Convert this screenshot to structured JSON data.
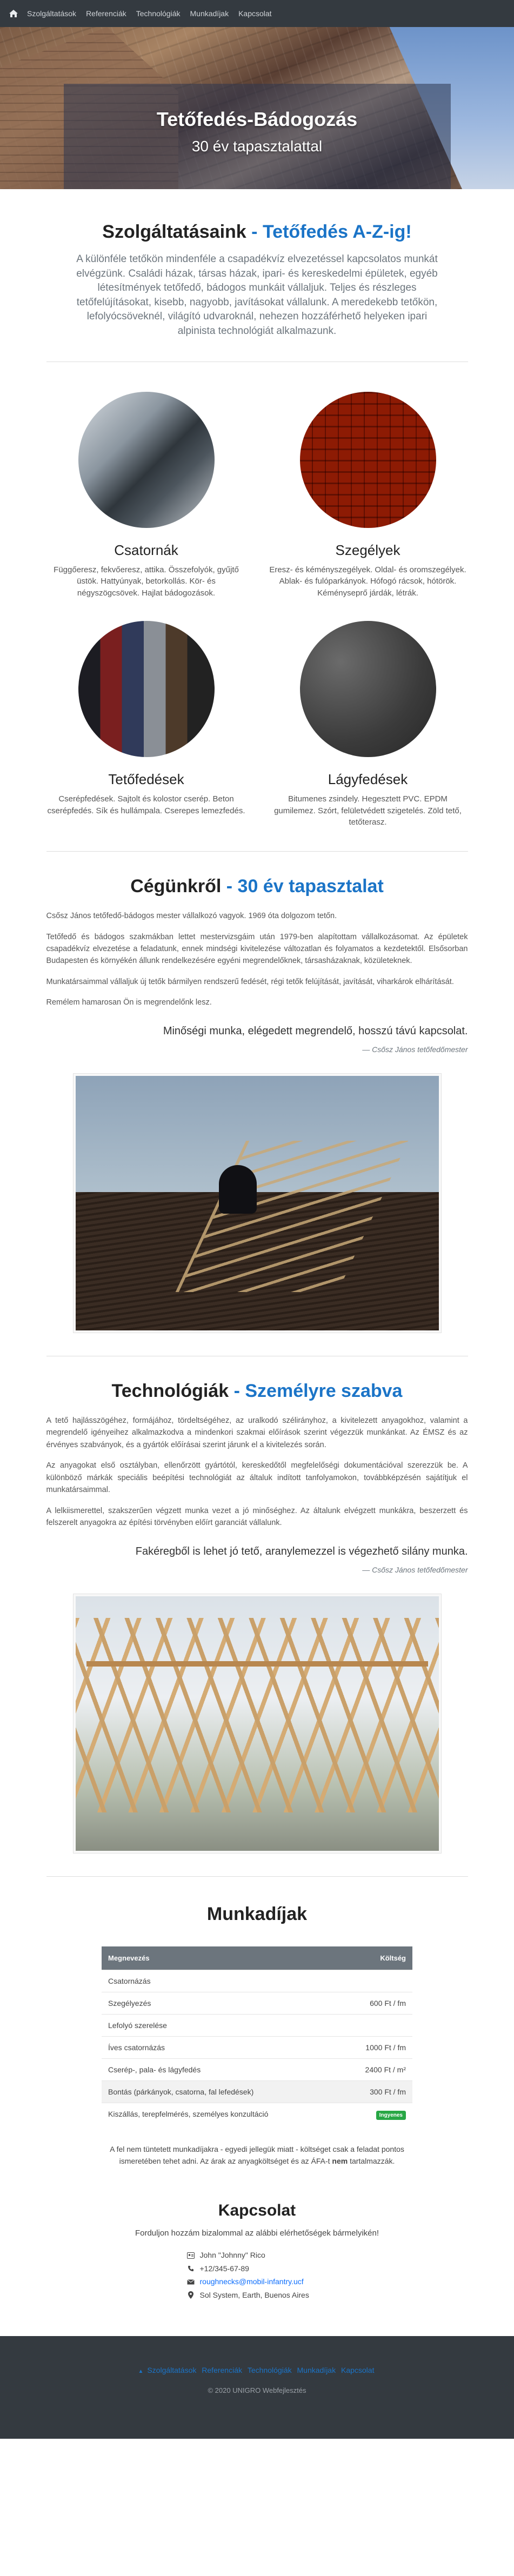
{
  "nav": {
    "items": [
      "Szolgáltatások",
      "Referenciák",
      "Technológiák",
      "Munkadíjak",
      "Kapcsolat"
    ]
  },
  "hero": {
    "title": "Tetőfedés-Bádogozás",
    "subtitle": "30 év tapasztalattal"
  },
  "services_section": {
    "title": "Szolgáltatásaink",
    "accent": "- Tetőfedés A-Z-ig!",
    "lead": "A különféle tetőkön mindenféle a csapadékvíz elvezetéssel kapcsolatos munkát elvégzünk. Családi házak, társas házak, ipari- és kereskedelmi épületek, egyéb létesítmények tetőfedő, bádogos munkáit vállaljuk. Teljes és részleges tetőfelújításokat, kisebb, nagyobb, javításokat vállalunk. A meredekebb tetőkön, lefolyócsöveknél, világító udvaroknál, nehezen hozzáférhető helyeken ipari alpinista technológiát alkalmazunk.",
    "items": [
      {
        "title": "Csatornák",
        "desc": "Függőeresz, fekvőeresz, attika. Összefolyók, gyűjtő üstök. Hattyúnyak, betorkollás. Kör- és négyszögcsövek. Hajlat bádogozások."
      },
      {
        "title": "Szegélyek",
        "desc": "Eresz- és kéményszegélyek. Oldal- és oromszegélyek. Ablak- és fulóparkányok. Hófogó rácsok, hótörök. Kéményseprő járdák, létrák."
      },
      {
        "title": "Tetőfedések",
        "desc": "Cserépfedések. Sajtolt és kolostor cserép. Beton cserépfedés. Sík és hullámpala. Cserepes lemezfedés."
      },
      {
        "title": "Lágyfedések",
        "desc": "Bitumenes zsindely. Hegesztett PVC. EPDM gumilemez. Szórt, felületvédett szigetelés. Zöld tető, tetőterasz."
      }
    ]
  },
  "about": {
    "title": "Cégünkről",
    "accent": "- 30 év tapasztalat",
    "p1": "Csősz János tetőfedő-bádogos mester vállalkozó vagyok. 1969 óta dolgozom tetőn.",
    "p2": "Tetőfedő és bádogos szakmákban lettet mestervizsgáim után 1979-ben alapítottam vállalkozásomat. Az épületek csapadékvíz elvezetése a feladatunk, ennek mindségi kivitelezése változatlan és folyamatos a kezdetektől. Elsősorban Budapesten és környékén állunk rendelkezésére egyéni megrendelőknek, társasházaknak, közületeknek.",
    "p3": "Munkatársaimmal vállaljuk új tetők bármilyen rendszerű fedését, régi tetők felújítását, javítását, viharkárok elhárítását.",
    "p4": "Remélem hamarosan Ön is megrendelőnk lesz.",
    "quote": "Minőségi munka, elégedett megrendelő, hosszú távú kapcsolat.",
    "quote_by": "— Csősz János tetőfedőmester"
  },
  "tech": {
    "title": "Technológiák",
    "accent": "- Személyre szabva",
    "p1": "A tető hajlásszögéhez, formájához, tördeltségéhez, az uralkodó szélirányhoz, a kivitelezett anyagokhoz, valamint a megrendelő igényeihez alkalmazkodva a mindenkori szakmai előírások szerint végezzük munkánkat. Az ÉMSZ és az érvényes szabványok, és a gyártók előírásai szerint járunk el a kivitelezés során.",
    "p2": "Az anyagokat első osztályban, ellenőrzött gyártótól, kereskedőtől megfelelőségi dokumentációval szerezzük be. A különböző márkák speciális beépítési technológiát az általuk indított tanfolyamokon, továbbképzésén sajátítjuk el munkatársaimmal.",
    "p3": "A lelkiismerettel, szakszerűen végzett munka vezet a jó minőséghez. Az általunk elvégzett munkákra, beszerzett és felszerelt anyagokra az építési törvényben előírt garanciát vállalunk.",
    "quote": "Fakéregből is lehet jó tető, aranylemezzel is végezhető silány munka.",
    "quote_by": "— Csősz János tetőfedőmester"
  },
  "prices": {
    "title": "Munkadíjak",
    "col1": "Megnevezés",
    "col2": "Költség",
    "rows": [
      {
        "name": "Csatornázás",
        "cost": ""
      },
      {
        "name": "Szegélyezés",
        "cost": "600 Ft / fm"
      },
      {
        "name": "Lefolyó szerelése",
        "cost": ""
      },
      {
        "name": "Íves csatornázás",
        "cost": "1000 Ft / fm"
      },
      {
        "name": "Cserép-, pala- és lágyfedés",
        "cost": "2400 Ft / m²"
      },
      {
        "name": "Bontás (párkányok, csatorna, fal lefedések)",
        "cost": "300 Ft / fm"
      },
      {
        "name": "Kiszállás, terepfelmérés, személyes konzultáció",
        "cost": "Ingyenes"
      }
    ],
    "note1": "A fel nem tüntetett munkadíjakra - egyedi jellegük miatt - költséget csak a feladat pontos ismeretében tehet adni. Az árak az anyagköltséget és az ÁFA-t",
    "note_bold": "nem",
    "note2": "tartalmazzák."
  },
  "contact": {
    "title": "Kapcsolat",
    "subtitle": "Forduljon hozzám bizalommal az alábbi elérhetőségek bármelyikén!",
    "name": "John \"Johnny\" Rico",
    "phone": "+12/345-67-89",
    "email": "roughnecks@mobil-infantry.ucf",
    "address": "Sol System, Earth, Buenos Aires"
  },
  "footer": {
    "links": [
      "Szolgáltatások",
      "Referenciák",
      "Technológiák",
      "Munkadíjak",
      "Kapcsolat"
    ],
    "copyright": "© 2020 UNIGRO Webfejlesztés"
  },
  "colors": {
    "accent": "#1b74c7",
    "navbar": "#343a40",
    "badge": "#28a745"
  }
}
